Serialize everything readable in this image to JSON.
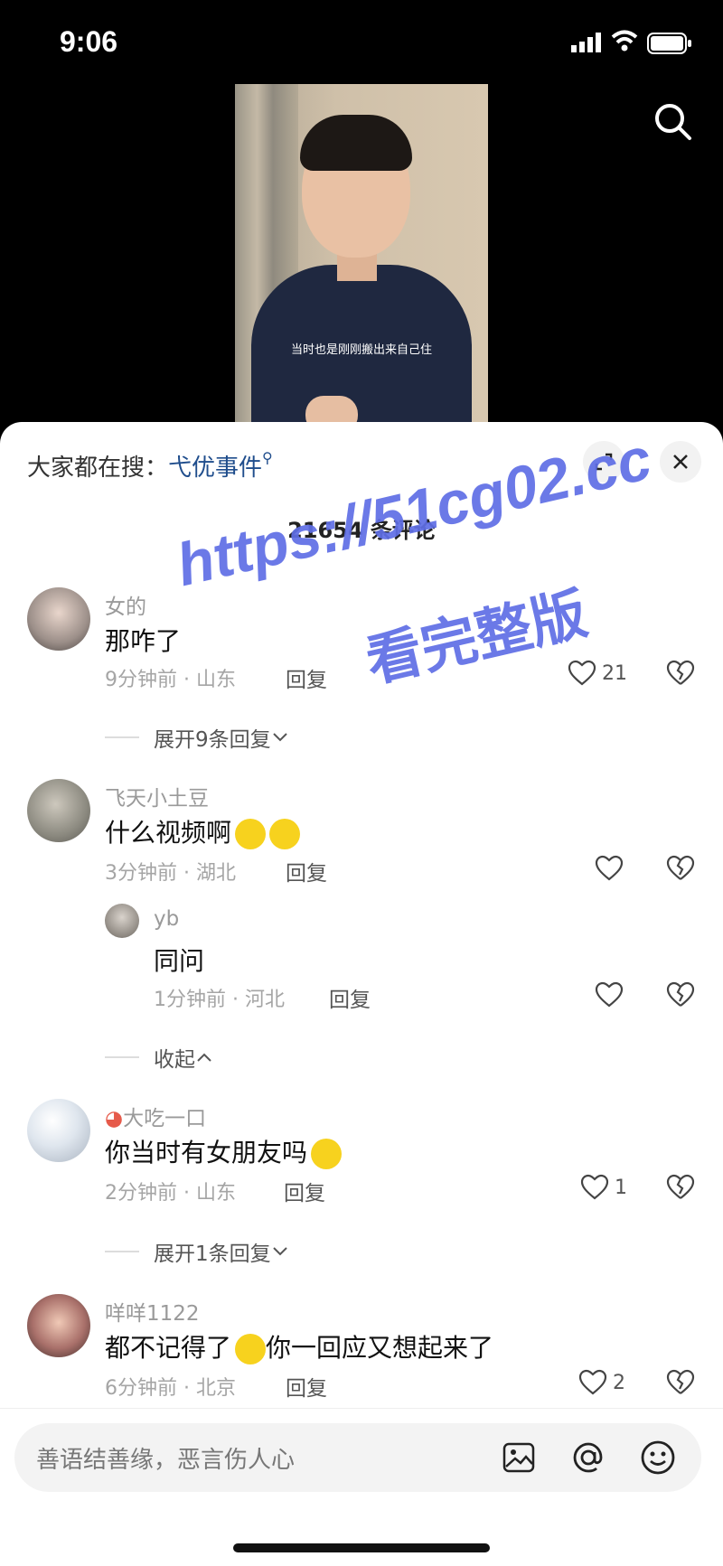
{
  "status_bar": {
    "time": "9:06"
  },
  "video": {
    "subtitle": "当时也是刚刚搬出来自己住"
  },
  "sheet": {
    "hot_search_label": "大家都在搜：",
    "hot_search_keyword": "弋优事件",
    "comment_count": "21654 条评论"
  },
  "comments": [
    {
      "name": "女的",
      "text": "那咋了",
      "time": "9分钟前 · 山东",
      "reply": "回复",
      "likes": "21",
      "expand": "展开9条回复"
    },
    {
      "name": "飞天小土豆",
      "text": "什么视频啊",
      "time": "3分钟前 · 湖北",
      "reply": "回复",
      "likes": ""
    },
    {
      "name": "yb",
      "text": "同问",
      "time": "1分钟前 · 河北",
      "reply": "回复",
      "likes": "",
      "collapse": "收起"
    },
    {
      "name": "大吃一口",
      "text": "你当时有女朋友吗",
      "time": "2分钟前 · 山东",
      "reply": "回复",
      "likes": "1",
      "expand": "展开1条回复"
    },
    {
      "name": "咩咩1122",
      "text": "都不记得了",
      "text2": "你一回应又想起来了",
      "time": "6分钟前 · 北京",
      "reply": "回复",
      "likes": "2"
    }
  ],
  "watermark": {
    "line1": "https://51cg02.cc",
    "line2": "看完整版"
  },
  "input": {
    "placeholder": "善语结善缘，恶言伤人心"
  },
  "icons": {
    "search": "search-icon",
    "expand": "expand-icon",
    "close": "close-icon",
    "heart": "heart-icon",
    "broken_heart": "broken-heart-icon",
    "image": "image-icon",
    "at": "at-icon",
    "emoji": "emoji-icon"
  }
}
